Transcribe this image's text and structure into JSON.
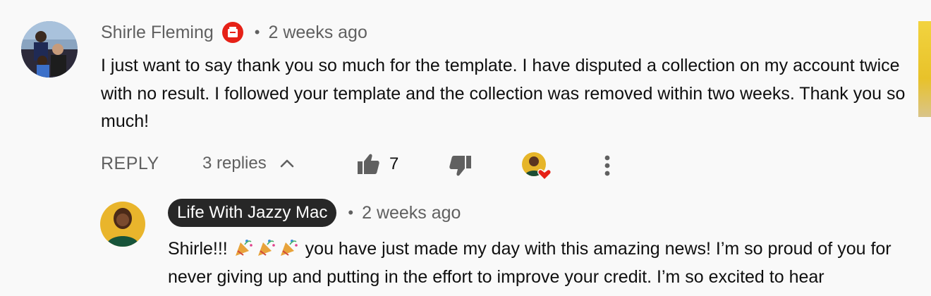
{
  "comment": {
    "author": "Shirle Fleming",
    "time": "2 weeks ago",
    "text": "I just want to say thank you so much for the template. I have disputed a collection on my account twice with no result. I followed your template and the collection was removed within two weeks. Thank you so much!",
    "badge_icon": "member-badge-icon",
    "actions": {
      "reply_label": "REPLY",
      "replies_label": "3 replies",
      "like_count": "7"
    }
  },
  "reply": {
    "author": "Life With Jazzy Mac",
    "time": "2 weeks ago",
    "text_before": "Shirle!!!",
    "emojis": [
      "party-popper",
      "party-popper",
      "party-popper"
    ],
    "text_after": "you have just made my day with this amazing news! I’m so proud of you for never giving up and putting in the effort to improve your credit. I’m so excited to hear"
  },
  "colors": {
    "background": "#f9f9f9",
    "secondary_text": "#606060",
    "badge_red": "#e62117",
    "pill_bg": "#272727",
    "heart": "#e62117"
  }
}
